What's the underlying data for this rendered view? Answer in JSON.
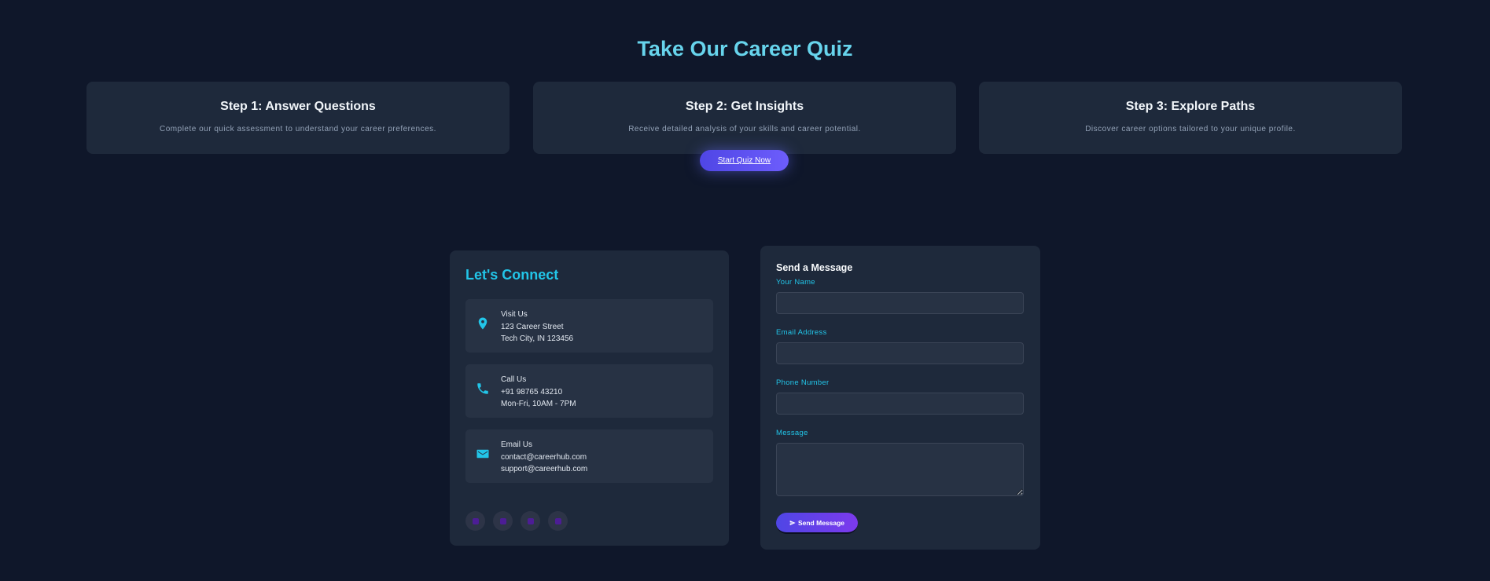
{
  "quiz": {
    "title": "Take Our Career Quiz",
    "steps": [
      {
        "title": "Step 1: Answer Questions",
        "desc": "Complete our quick assessment to understand your career preferences."
      },
      {
        "title": "Step 2: Get Insights",
        "desc": "Receive detailed analysis of your skills and career potential."
      },
      {
        "title": "Step 3: Explore Paths",
        "desc": "Discover career options tailored to your unique profile."
      }
    ],
    "button": "Start Quiz Now"
  },
  "connect": {
    "title": "Let's Connect",
    "items": [
      {
        "icon": "map-pin-icon",
        "label": "Visit Us",
        "line1": "123 Career Street",
        "line2": "Tech City, IN 123456"
      },
      {
        "icon": "phone-icon",
        "label": "Call Us",
        "line1": "+91 98765 43210",
        "line2": "Mon-Fri, 10AM - 7PM"
      },
      {
        "icon": "envelope-icon",
        "label": "Email Us",
        "line1": "contact@careerhub.com",
        "line2": "support@careerhub.com"
      }
    ],
    "social_icons": [
      "linkedin-icon",
      "twitter-icon",
      "instagram-icon",
      "youtube-icon"
    ]
  },
  "message_form": {
    "title": "Send a Message",
    "name_label": "Your Name",
    "name_value": "",
    "email_label": "Email Address",
    "email_value": "",
    "phone_label": "Phone Number",
    "phone_value": "",
    "message_label": "Message",
    "message_value": "",
    "send_button": "Send Message"
  },
  "colors": {
    "background": "#0f172a",
    "card": "#1e293b",
    "accent_cyan": "#22c5e8",
    "button_gradient_start": "#4f46e5",
    "button_gradient_end": "#7c3aed"
  }
}
